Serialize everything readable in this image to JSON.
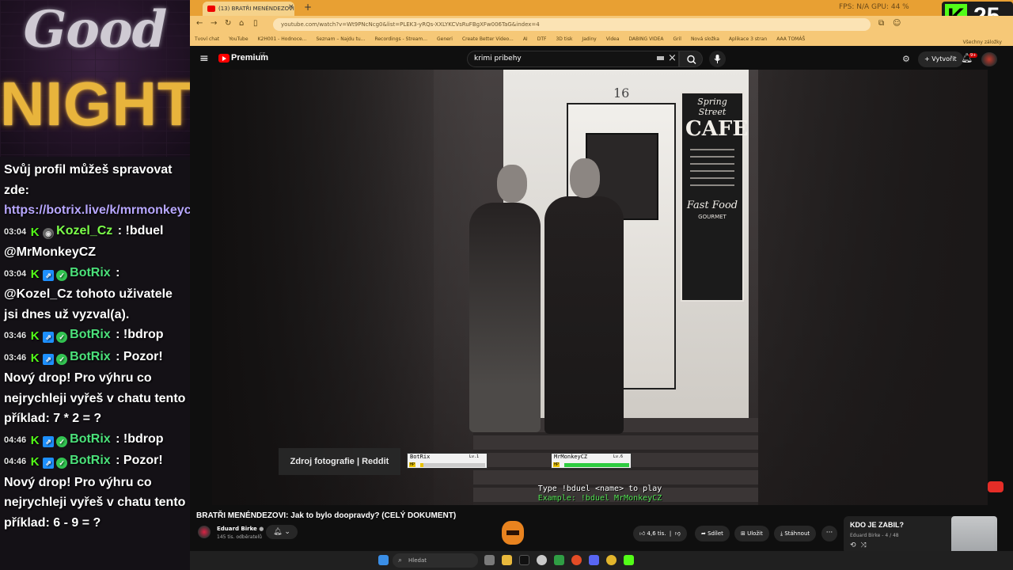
{
  "overlay": {
    "banner_top": "Good",
    "banner_bottom": "NIGHT",
    "kick_letter": "K",
    "kick_counter": "25"
  },
  "chat": [
    {
      "ts": "",
      "user": "",
      "badges": [],
      "text": "Svůj profil můžeš spravovat zde:",
      "link": "https://botrix.live/k/mrmonkeycz/battle"
    },
    {
      "ts": "03:04",
      "user": "Kozel_Cz",
      "user_color": "#7cff4a",
      "badges": [
        "kick",
        "grey"
      ],
      "text": "!bduel @MrMonkeyCZ"
    },
    {
      "ts": "03:04",
      "user": "BotRix",
      "user_color": "#4be17a",
      "badges": [
        "kick",
        "bot",
        "ok"
      ],
      "text": "@Kozel_Cz tohoto uživatele jsi dnes už vyzval(a)."
    },
    {
      "ts": "03:46",
      "user": "BotRix",
      "user_color": "#4be17a",
      "badges": [
        "kick",
        "bot",
        "ok"
      ],
      "text": "!bdrop"
    },
    {
      "ts": "03:46",
      "user": "BotRix",
      "user_color": "#4be17a",
      "badges": [
        "kick",
        "bot",
        "ok"
      ],
      "text": "Pozor! Nový drop! Pro výhru co nejrychleji vyřeš v chatu tento příklad: 7 * 2 = ?"
    },
    {
      "ts": "04:46",
      "user": "BotRix",
      "user_color": "#4be17a",
      "badges": [
        "kick",
        "bot",
        "ok"
      ],
      "text": "!bdrop"
    },
    {
      "ts": "04:46",
      "user": "BotRix",
      "user_color": "#4be17a",
      "badges": [
        "kick",
        "bot",
        "ok"
      ],
      "text": "Pozor! Nový drop! Pro výhru co nejrychleji vyřeš v chatu tento příklad: 6 - 9 = ?"
    }
  ],
  "browser": {
    "tab_title": "(13) BRATŘI MENÉNDEZOVI",
    "tab_close": "×",
    "new_tab": "+",
    "sys_stats": "FPS: N/A    GPU: 44 %",
    "url": "youtube.com/watch?v=Wt9PNcNcg0&list=PLEK3-yRQs-XXLYKCVsRuFBgXFw006TaG&index=4",
    "bookmarks": [
      "Tvoví chat",
      "YouTube",
      "K2H001 - Hodnoce...",
      "Seznam – Najdu tu...",
      "Recordings - Stream...",
      "Generi",
      "Create Better Video...",
      "AI",
      "DTF",
      "3D tisk",
      "Jadiny",
      "Videa",
      "DABING VIDEA",
      "Gril",
      "Nová složka",
      "Aplikace 3 stran",
      "AAA TOMÁŠ"
    ],
    "bookmarks_all": "Všechny záložky"
  },
  "youtube": {
    "premium": "Premium",
    "region": "CZ",
    "search_value": "krimi pribehy",
    "create_label": "Vytvořit",
    "notif_count": "9+",
    "video_title": "BRATŘI MENÉNDEZOVI: Jak to bylo doopravdy? (CELÝ DOKUMENT)",
    "channel_name": "Eduard Birke",
    "channel_subs": "145 tis. odběratelů",
    "likes": "4,6 tis.",
    "share": "Sdílet",
    "save": "Uložit",
    "download": "Stáhnout",
    "more": "···",
    "playlist_title": "KDO JE ZABIL?",
    "playlist_meta": "Eduard Birke - 4 / 48"
  },
  "video": {
    "door_number": "16",
    "cafe_top": "Spring Street",
    "cafe_title": "CAFE",
    "cafe_fast": "Fast Food",
    "cafe_gourmet": "GOURMET",
    "caption": "Zdroj fotografie | Reddit",
    "duel_left": {
      "name": "BotRix",
      "level": "Lv.1",
      "hp_label": "HP",
      "hp_fraction": 0.05,
      "hp_color": "#e8c200"
    },
    "duel_right": {
      "name": "MrMonkeyCZ",
      "level": "Lv.6",
      "hp_label": "HP",
      "hp_fraction": 1.0,
      "hp_color": "#2ecc40"
    },
    "prompt": "Type !bduel <name> to play",
    "example": "Example: !bduel MrMonkeyCZ"
  },
  "taskbar": {
    "search_placeholder": "Hledat"
  },
  "colors": {
    "kick_green": "#53fc18",
    "youtube_red": "#ff0000",
    "neon_gold": "#e8b43c",
    "browser_theme": "#e8a033"
  }
}
